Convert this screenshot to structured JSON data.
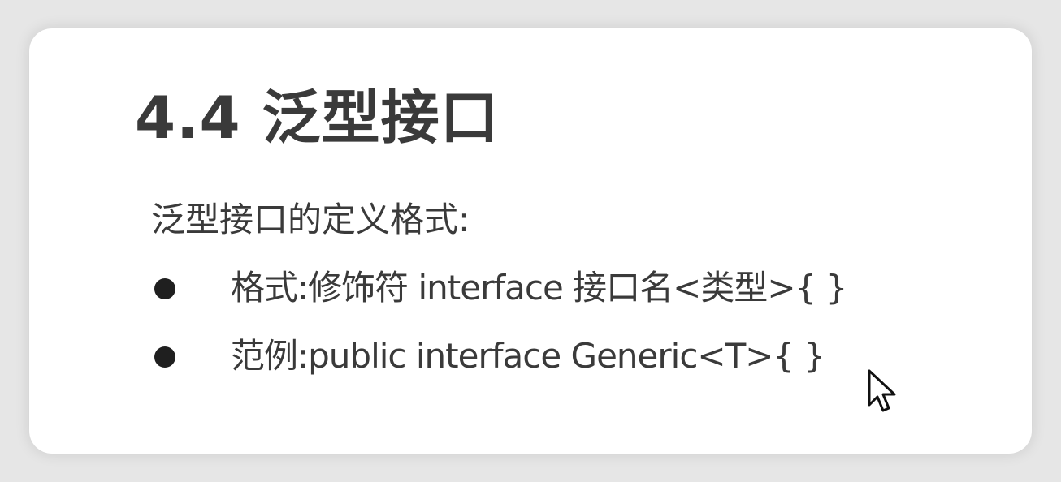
{
  "slide": {
    "title": "4.4 泛型接口",
    "intro": "泛型接口的定义格式:",
    "bullets": [
      {
        "text": "格式:修饰符 interface 接口名<类型>{  }"
      },
      {
        "text": "范例:public interface Generic<T>{  }"
      }
    ]
  },
  "cursor": {
    "icon": "arrow-pointer-icon"
  }
}
